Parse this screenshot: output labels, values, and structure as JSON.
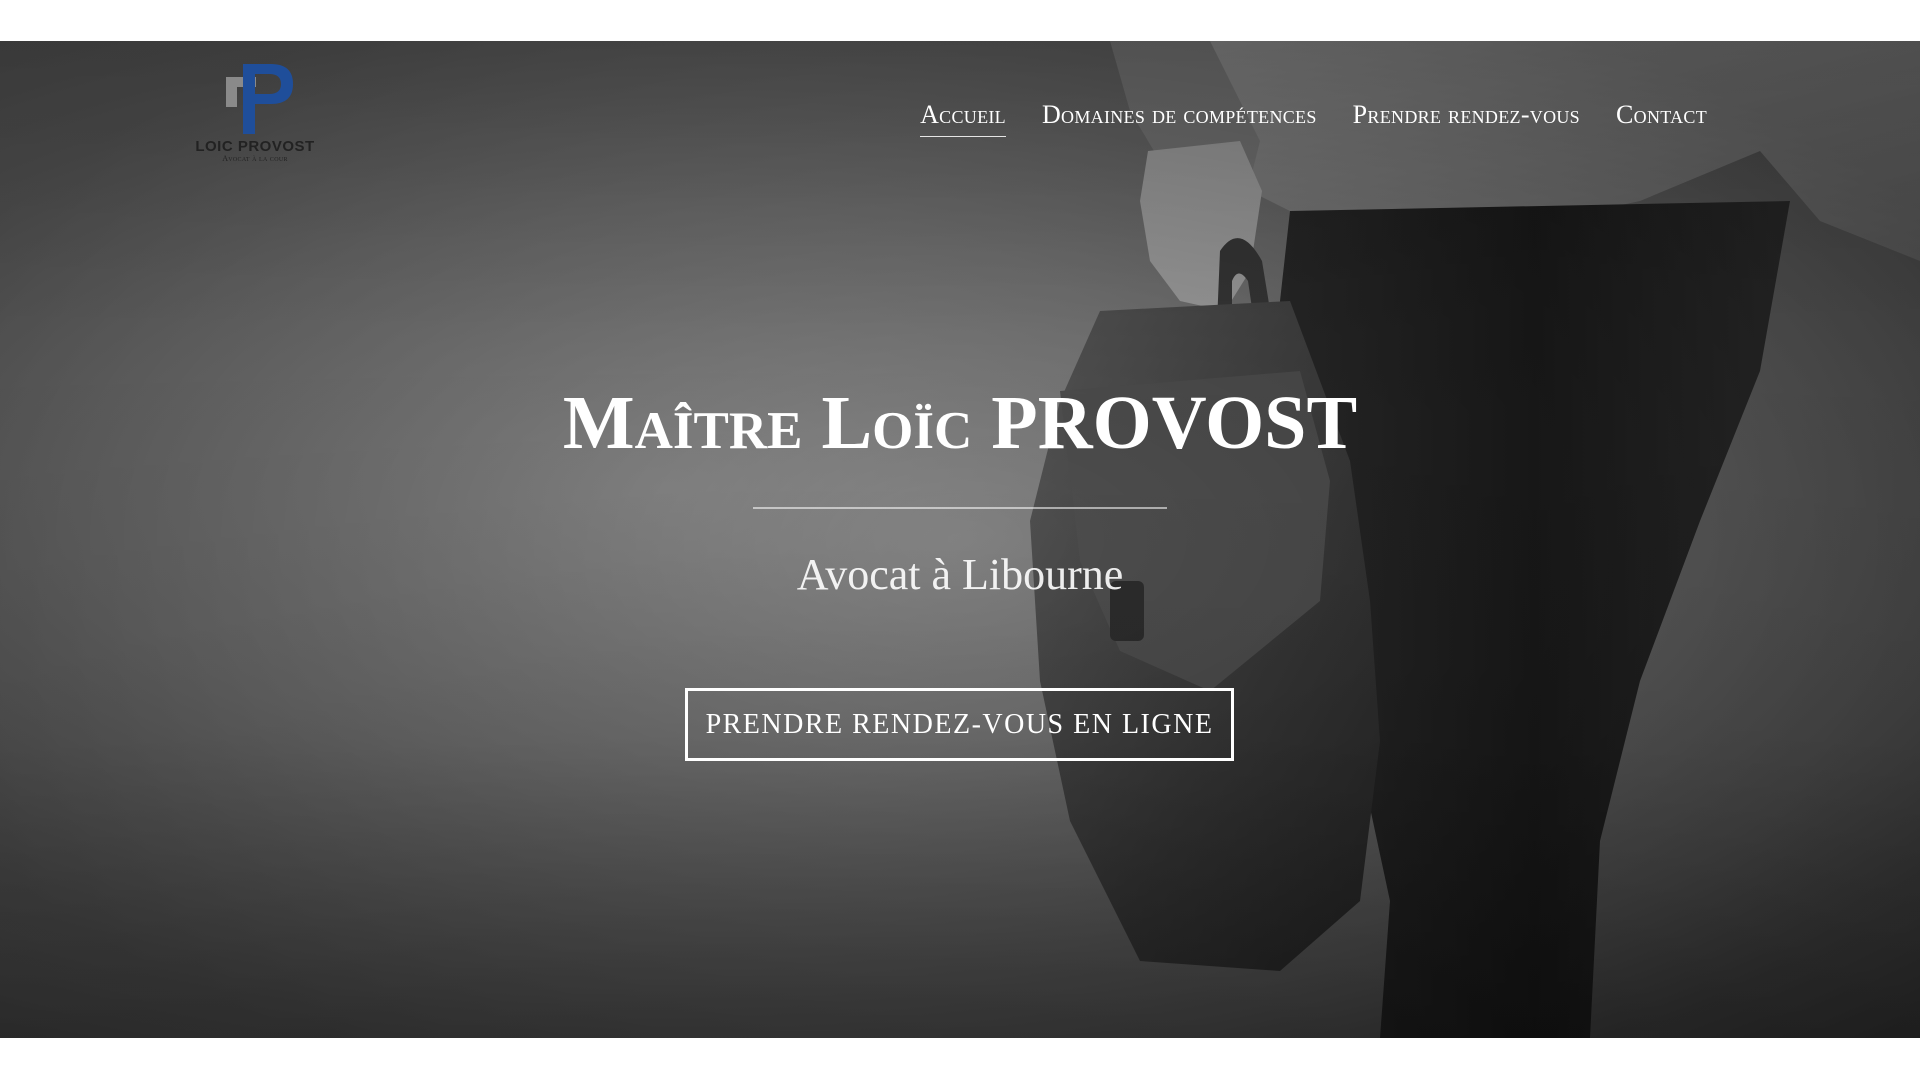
{
  "site": {
    "logo": {
      "name": "LOIC PROVOST",
      "tagline": "Avocat à la cour",
      "colors": {
        "primary": "#1f4e9a",
        "secondary": "#8a8a8a"
      }
    }
  },
  "nav": {
    "items": [
      {
        "label": "Accueil",
        "active": true
      },
      {
        "label": "Domaines de compétences",
        "active": false
      },
      {
        "label": "Prendre rendez-vous",
        "active": false
      },
      {
        "label": "Contact",
        "active": false
      }
    ]
  },
  "hero": {
    "title_prefix": "Maître Loïc",
    "title_name": "PROVOST",
    "subtitle": "Avocat à Libourne",
    "cta_label": "PRENDRE RENDEZ-VOUS EN LIGNE",
    "background": "black-and-white photo: person walking carrying a leather briefcase"
  },
  "colors": {
    "text": "#ffffff",
    "page_background": "#ffffff"
  }
}
